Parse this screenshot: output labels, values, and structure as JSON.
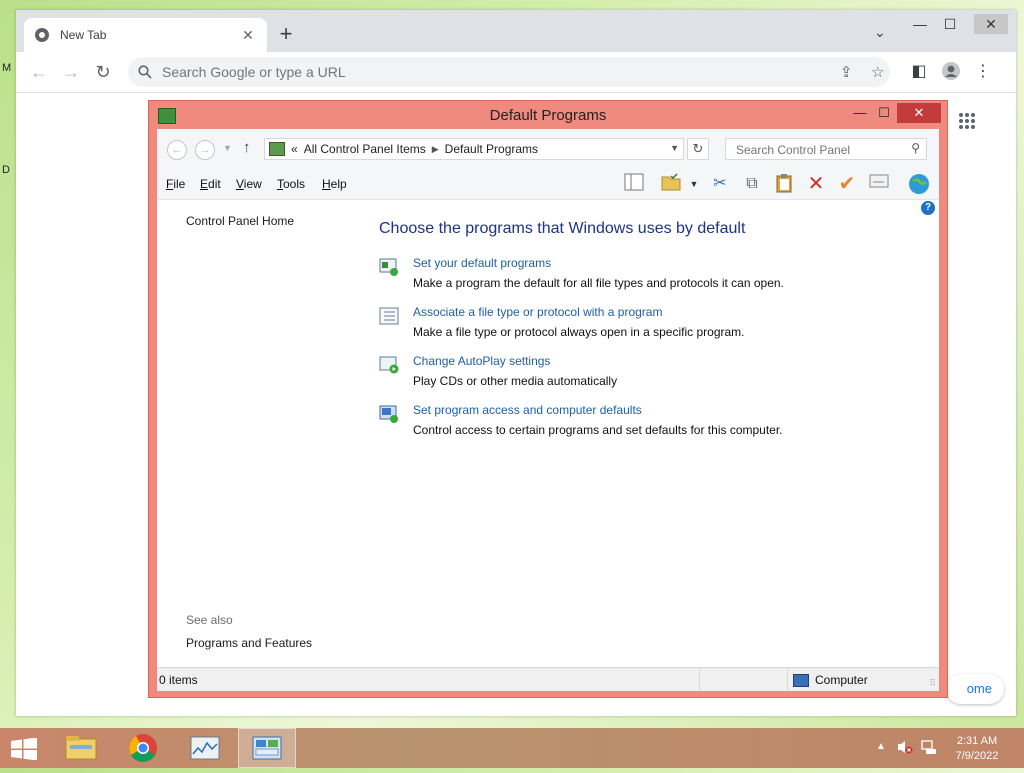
{
  "browser": {
    "tab": {
      "title": "New Tab"
    },
    "omnibox": {
      "placeholder": "Search Google or type a URL"
    },
    "customize_chip": "ome"
  },
  "explorer": {
    "title": "Default Programs",
    "breadcrumb": {
      "prefix": "«",
      "items": [
        "All Control Panel Items",
        "Default Programs"
      ]
    },
    "search": {
      "placeholder": "Search Control Panel"
    },
    "menu": [
      {
        "label": "File",
        "accel": "F",
        "rest": "ile"
      },
      {
        "label": "Edit",
        "accel": "E",
        "rest": "dit"
      },
      {
        "label": "View",
        "accel": "V",
        "rest": "iew"
      },
      {
        "label": "Tools",
        "accel": "T",
        "rest": "ools"
      },
      {
        "label": "Help",
        "accel": "H",
        "rest": "elp"
      }
    ],
    "left_pane": {
      "home": "Control Panel Home",
      "see_also": "See also",
      "see_also_links": [
        "Programs and Features"
      ]
    },
    "main": {
      "heading": "Choose the programs that Windows uses by default",
      "tasks": [
        {
          "link": "Set your default programs",
          "desc": "Make a program the default for all file types and protocols it can open."
        },
        {
          "link": "Associate a file type or protocol with a program",
          "desc": "Make a file type or protocol always open in a specific program."
        },
        {
          "link": "Change AutoPlay settings",
          "desc": "Play CDs or other media automatically"
        },
        {
          "link": "Set program access and computer defaults",
          "desc": "Control access to certain programs and set defaults for this computer."
        }
      ]
    },
    "status": {
      "items": "0 items",
      "zone": "Computer"
    }
  },
  "taskbar": {
    "clock": {
      "time": "2:31 AM",
      "date": "7/9/2022"
    }
  },
  "colors": {
    "explorer_frame": "#f08a7e",
    "link": "#1e5fa8",
    "heading": "#1e3287",
    "taskbar": "#c08466"
  }
}
